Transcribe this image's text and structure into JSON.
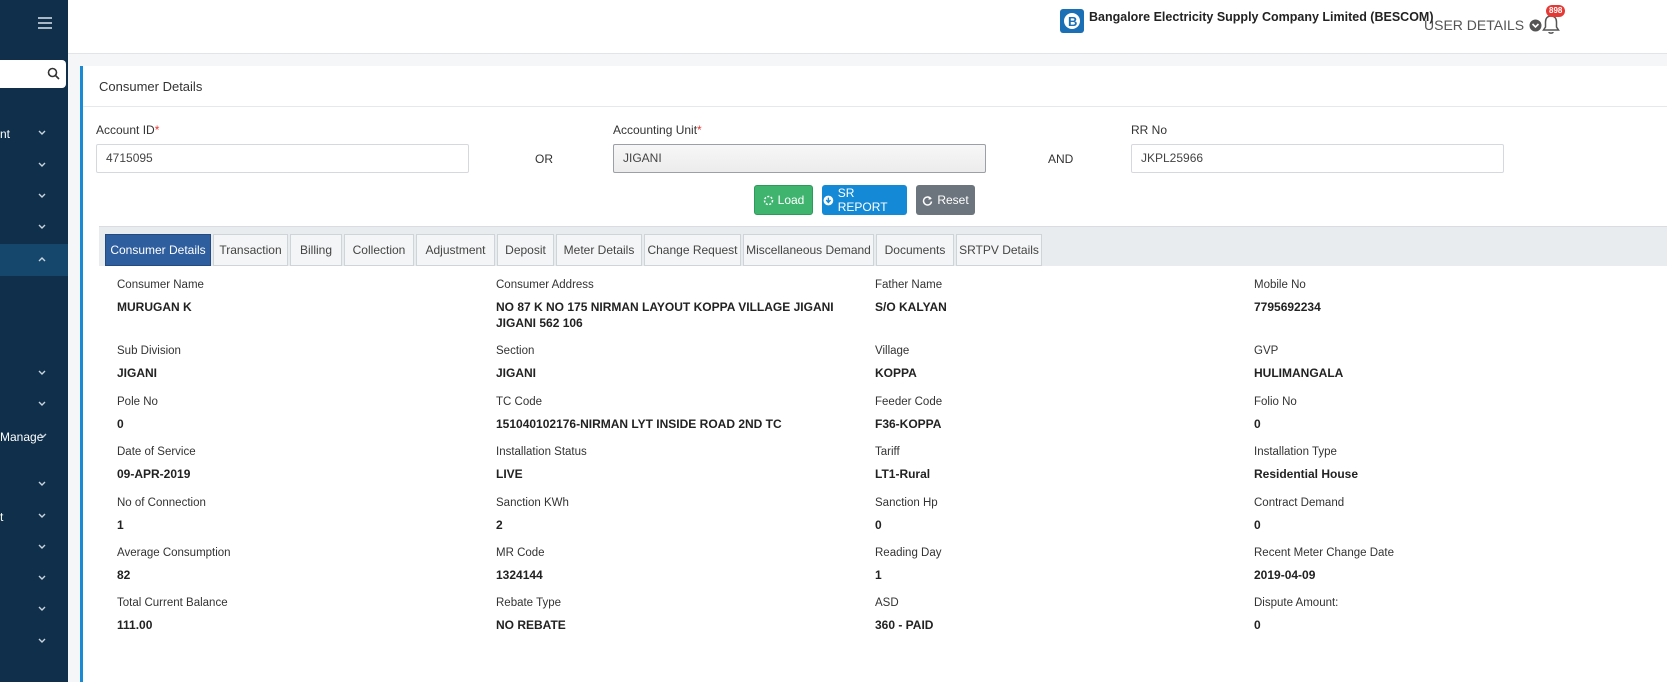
{
  "sidebar": {
    "search_icon": "search-icon",
    "items": [
      {
        "label": "nt",
        "icon": "chevron-down-icon"
      },
      {
        "label": "",
        "icon": "chevron-down-icon"
      },
      {
        "label": "",
        "icon": "chevron-down-icon"
      },
      {
        "label": "",
        "icon": "chevron-down-icon"
      },
      {
        "label": "",
        "icon": "chevron-up-icon"
      },
      {
        "label": "",
        "icon": "chevron-down-icon"
      },
      {
        "label": "",
        "icon": "chevron-down-icon"
      },
      {
        "label": "Manage",
        "icon": "chevron-down-icon"
      },
      {
        "label": "",
        "icon": "chevron-down-icon"
      },
      {
        "label": "t",
        "icon": "chevron-down-icon"
      },
      {
        "label": "",
        "icon": "chevron-down-icon"
      },
      {
        "label": "",
        "icon": "chevron-down-icon"
      },
      {
        "label": "",
        "icon": "chevron-down-icon"
      },
      {
        "label": "",
        "icon": "chevron-down-icon"
      }
    ]
  },
  "header": {
    "company": "Bangalore Electricity Supply Company Limited (BESCOM)",
    "user_details": "USER DETAILS",
    "notification_count": "898"
  },
  "form": {
    "title": "Consumer Details",
    "account_id_label": "Account ID",
    "account_id_value": "4715095",
    "or_label": "OR",
    "accounting_unit_label": "Accounting Unit",
    "accounting_unit_value": "JIGANI",
    "and_label": "AND",
    "rr_no_label": "RR No",
    "rr_no_value": "JKPL25966",
    "required_mark": "*",
    "load_button": "Load",
    "sr_report_button": "SR REPORT",
    "reset_button": "Reset"
  },
  "tabs": [
    {
      "label": "Consumer Details",
      "active": true
    },
    {
      "label": "Transaction",
      "active": false
    },
    {
      "label": "Billing",
      "active": false
    },
    {
      "label": "Collection",
      "active": false
    },
    {
      "label": "Adjustment",
      "active": false
    },
    {
      "label": "Deposit",
      "active": false
    },
    {
      "label": "Meter Details",
      "active": false
    },
    {
      "label": "Change Request",
      "active": false
    },
    {
      "label": "Miscellaneous Demand",
      "active": false
    },
    {
      "label": "Documents",
      "active": false
    },
    {
      "label": "SRTPV Details",
      "active": false
    }
  ],
  "details": [
    [
      {
        "label": "Consumer Name",
        "value": "MURUGAN K"
      },
      {
        "label": "Consumer Address",
        "value": "NO 87 K NO 175 NIRMAN LAYOUT KOPPA VILLAGE JIGANI JIGANI 562 106"
      },
      {
        "label": "Father Name",
        "value": "S/O KALYAN"
      },
      {
        "label": "Mobile No",
        "value": "7795692234"
      }
    ],
    [
      {
        "label": "Sub Division",
        "value": "JIGANI"
      },
      {
        "label": "Section",
        "value": "JIGANI"
      },
      {
        "label": "Village",
        "value": "KOPPA"
      },
      {
        "label": "GVP",
        "value": "HULIMANGALA"
      }
    ],
    [
      {
        "label": "Pole No",
        "value": "0"
      },
      {
        "label": "TC Code",
        "value": "151040102176-NIRMAN LYT INSIDE ROAD 2ND TC"
      },
      {
        "label": "Feeder Code",
        "value": "F36-KOPPA"
      },
      {
        "label": "Folio No",
        "value": "0"
      }
    ],
    [
      {
        "label": "Date of Service",
        "value": "09-APR-2019"
      },
      {
        "label": "Installation Status",
        "value": "LIVE"
      },
      {
        "label": "Tariff",
        "value": "LT1-Rural"
      },
      {
        "label": "Installation Type",
        "value": "Residential House"
      }
    ],
    [
      {
        "label": "No of Connection",
        "value": "1"
      },
      {
        "label": "Sanction KWh",
        "value": "2"
      },
      {
        "label": "Sanction Hp",
        "value": "0"
      },
      {
        "label": "Contract Demand",
        "value": "0"
      }
    ],
    [
      {
        "label": "Average Consumption",
        "value": "82"
      },
      {
        "label": "MR Code",
        "value": "1324144"
      },
      {
        "label": "Reading Day",
        "value": "1"
      },
      {
        "label": "Recent Meter Change Date",
        "value": "2019-04-09"
      }
    ],
    [
      {
        "label": "Total Current Balance",
        "value": "111.00"
      },
      {
        "label": "Rebate Type",
        "value": "NO REBATE"
      },
      {
        "label": "ASD",
        "value": "360 - PAID"
      },
      {
        "label": "Dispute Amount:",
        "value": "0"
      }
    ]
  ],
  "colors": {
    "sidebar": "#0f2f4a",
    "accent": "#1a8ad4",
    "load": "#3fb46f",
    "sr_report": "#1489d6",
    "reset": "#6c757d",
    "active_tab": "#2f5e9e"
  }
}
